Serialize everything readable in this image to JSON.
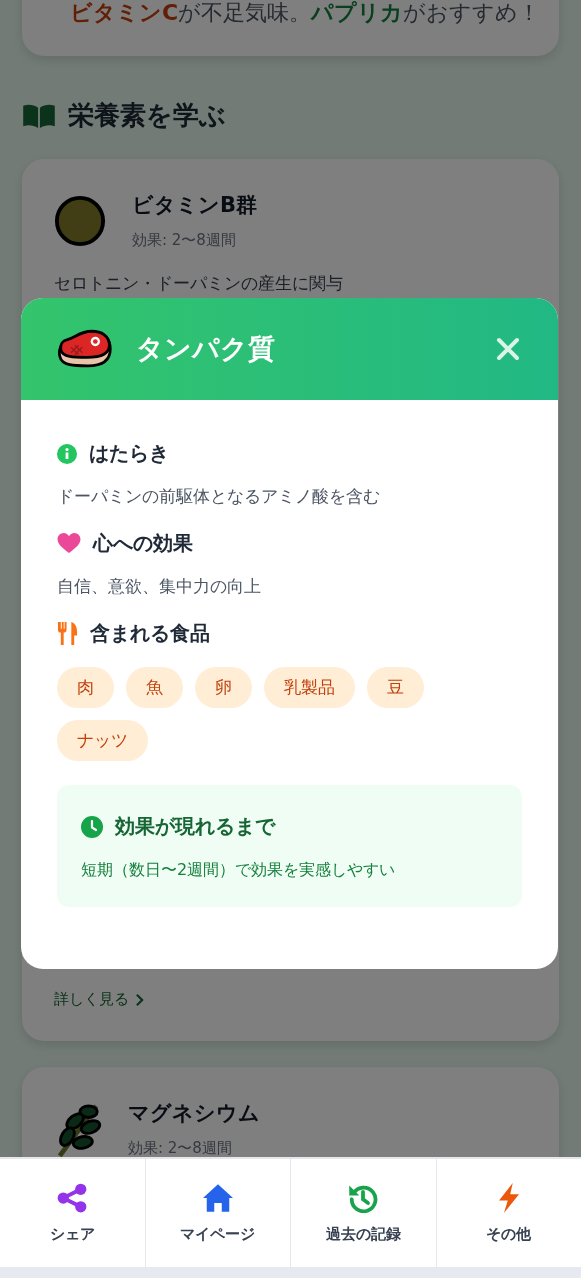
{
  "background": {
    "tip": {
      "segments": [
        {
          "kind": "nutrient",
          "text": "ビタミンC"
        },
        {
          "kind": "plain",
          "text": "が不足気味。"
        },
        {
          "kind": "food",
          "text": "パプリカ"
        },
        {
          "kind": "plain",
          "text": "がおすすめ！"
        }
      ]
    },
    "section_title": "栄養素を学ぶ",
    "nutrients": [
      {
        "kind": "vitamin",
        "name": "ビタミンB群",
        "effect": "効果: 2〜8週間",
        "description": "セロトニン・ドーパミンの産生に関与",
        "link": "詳しく見る"
      },
      {
        "kind": "mineral",
        "name": "マグネシウム",
        "effect": "効果: 2〜8週間"
      }
    ]
  },
  "modal": {
    "title": "タンパク質",
    "sections": [
      {
        "kind": "info",
        "heading": "はたらき",
        "text": "ドーパミンの前駆体となるアミノ酸を含む"
      },
      {
        "kind": "heart",
        "heading": "心への効果",
        "text": "自信、意欲、集中力の向上"
      },
      {
        "kind": "foods",
        "heading": "含まれる食品",
        "foods": [
          "肉",
          "魚",
          "卵",
          "乳製品",
          "豆",
          "ナッツ"
        ]
      }
    ],
    "timing": {
      "heading": "効果が現れるまで",
      "text": "短期（数日〜2週間）で効果を実感しやすい"
    }
  },
  "nav": [
    {
      "kind": "share",
      "label": "シェア"
    },
    {
      "kind": "home",
      "label": "マイページ"
    },
    {
      "kind": "history",
      "label": "過去の記録"
    },
    {
      "kind": "other",
      "label": "その他"
    }
  ]
}
